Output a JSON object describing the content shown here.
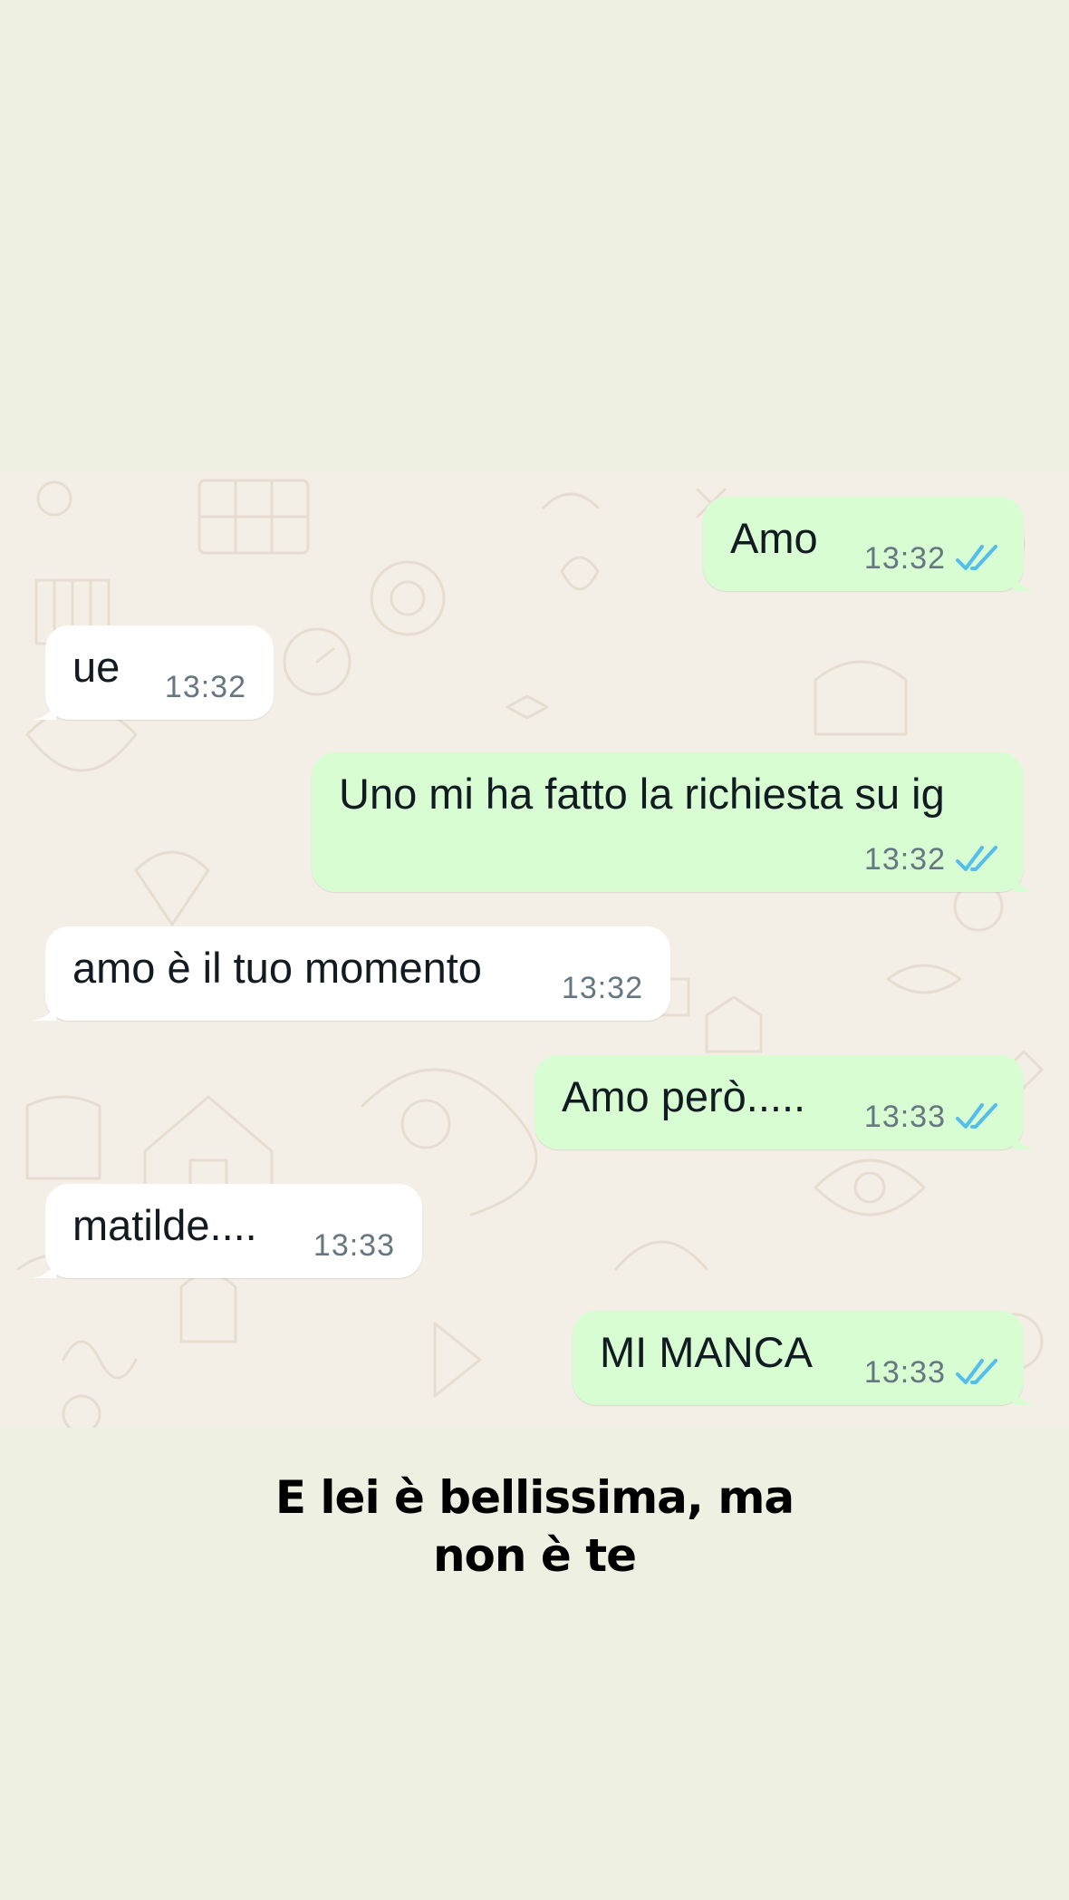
{
  "messages": [
    {
      "direction": "outgoing",
      "text": "Amo",
      "time": "13:32",
      "read_ticks": "double-check-icon"
    },
    {
      "direction": "incoming",
      "text": "ue",
      "time": "13:32"
    },
    {
      "direction": "outgoing",
      "text": "Uno mi ha fatto la richiesta su ig",
      "time": "13:32",
      "read_ticks": "double-check-icon"
    },
    {
      "direction": "incoming",
      "text": "amo è il tuo momento",
      "time": "13:32"
    },
    {
      "direction": "outgoing",
      "text": "Amo però.....",
      "time": "13:33",
      "read_ticks": "double-check-icon"
    },
    {
      "direction": "incoming",
      "text": "matilde....",
      "time": "13:33"
    },
    {
      "direction": "outgoing",
      "text": "MI MANCA",
      "time": "13:33",
      "read_ticks": "double-check-icon"
    }
  ],
  "caption": {
    "line1": "E lei è bellissima, ma",
    "line2": "non è te"
  },
  "colors": {
    "page_background": "#eef0e2",
    "chat_wallpaper": "#f4efe6",
    "outgoing_bubble": "#d9fdd3",
    "incoming_bubble": "#ffffff",
    "read_tick": "#53bdeb",
    "timestamp": "#667781"
  }
}
